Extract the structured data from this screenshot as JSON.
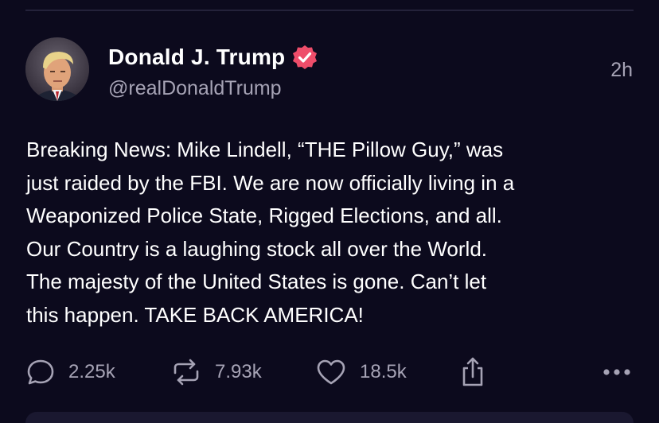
{
  "post": {
    "author_name": "Donald J. Trump",
    "author_handle": "@realDonaldTrump",
    "timestamp": "2h",
    "text": "Breaking News: Mike Lindell, “THE Pillow Guy,” was\njust raided by the FBI. We are now officially living in a\nWeaponized Police State, Rigged Elections, and all.\nOur Country is a laughing stock all over the World.\nThe majesty of the United States is gone. Can’t let\nthis happen. TAKE BACK AMERICA!",
    "verified": true
  },
  "actions": {
    "reply_count": "2.25k",
    "repost_count": "7.93k",
    "like_count": "18.5k"
  },
  "icons": {
    "reply": "speech-bubble-icon",
    "repost": "repost-arrows-icon",
    "like": "heart-icon",
    "share": "share-upload-icon",
    "more": "more-dots-icon",
    "verified": "verified-badge-icon"
  },
  "colors": {
    "background": "#0c0a1d",
    "text_primary": "#ffffff",
    "text_secondary": "#a6a3b5",
    "verified_badge": "#ee4d6a"
  }
}
